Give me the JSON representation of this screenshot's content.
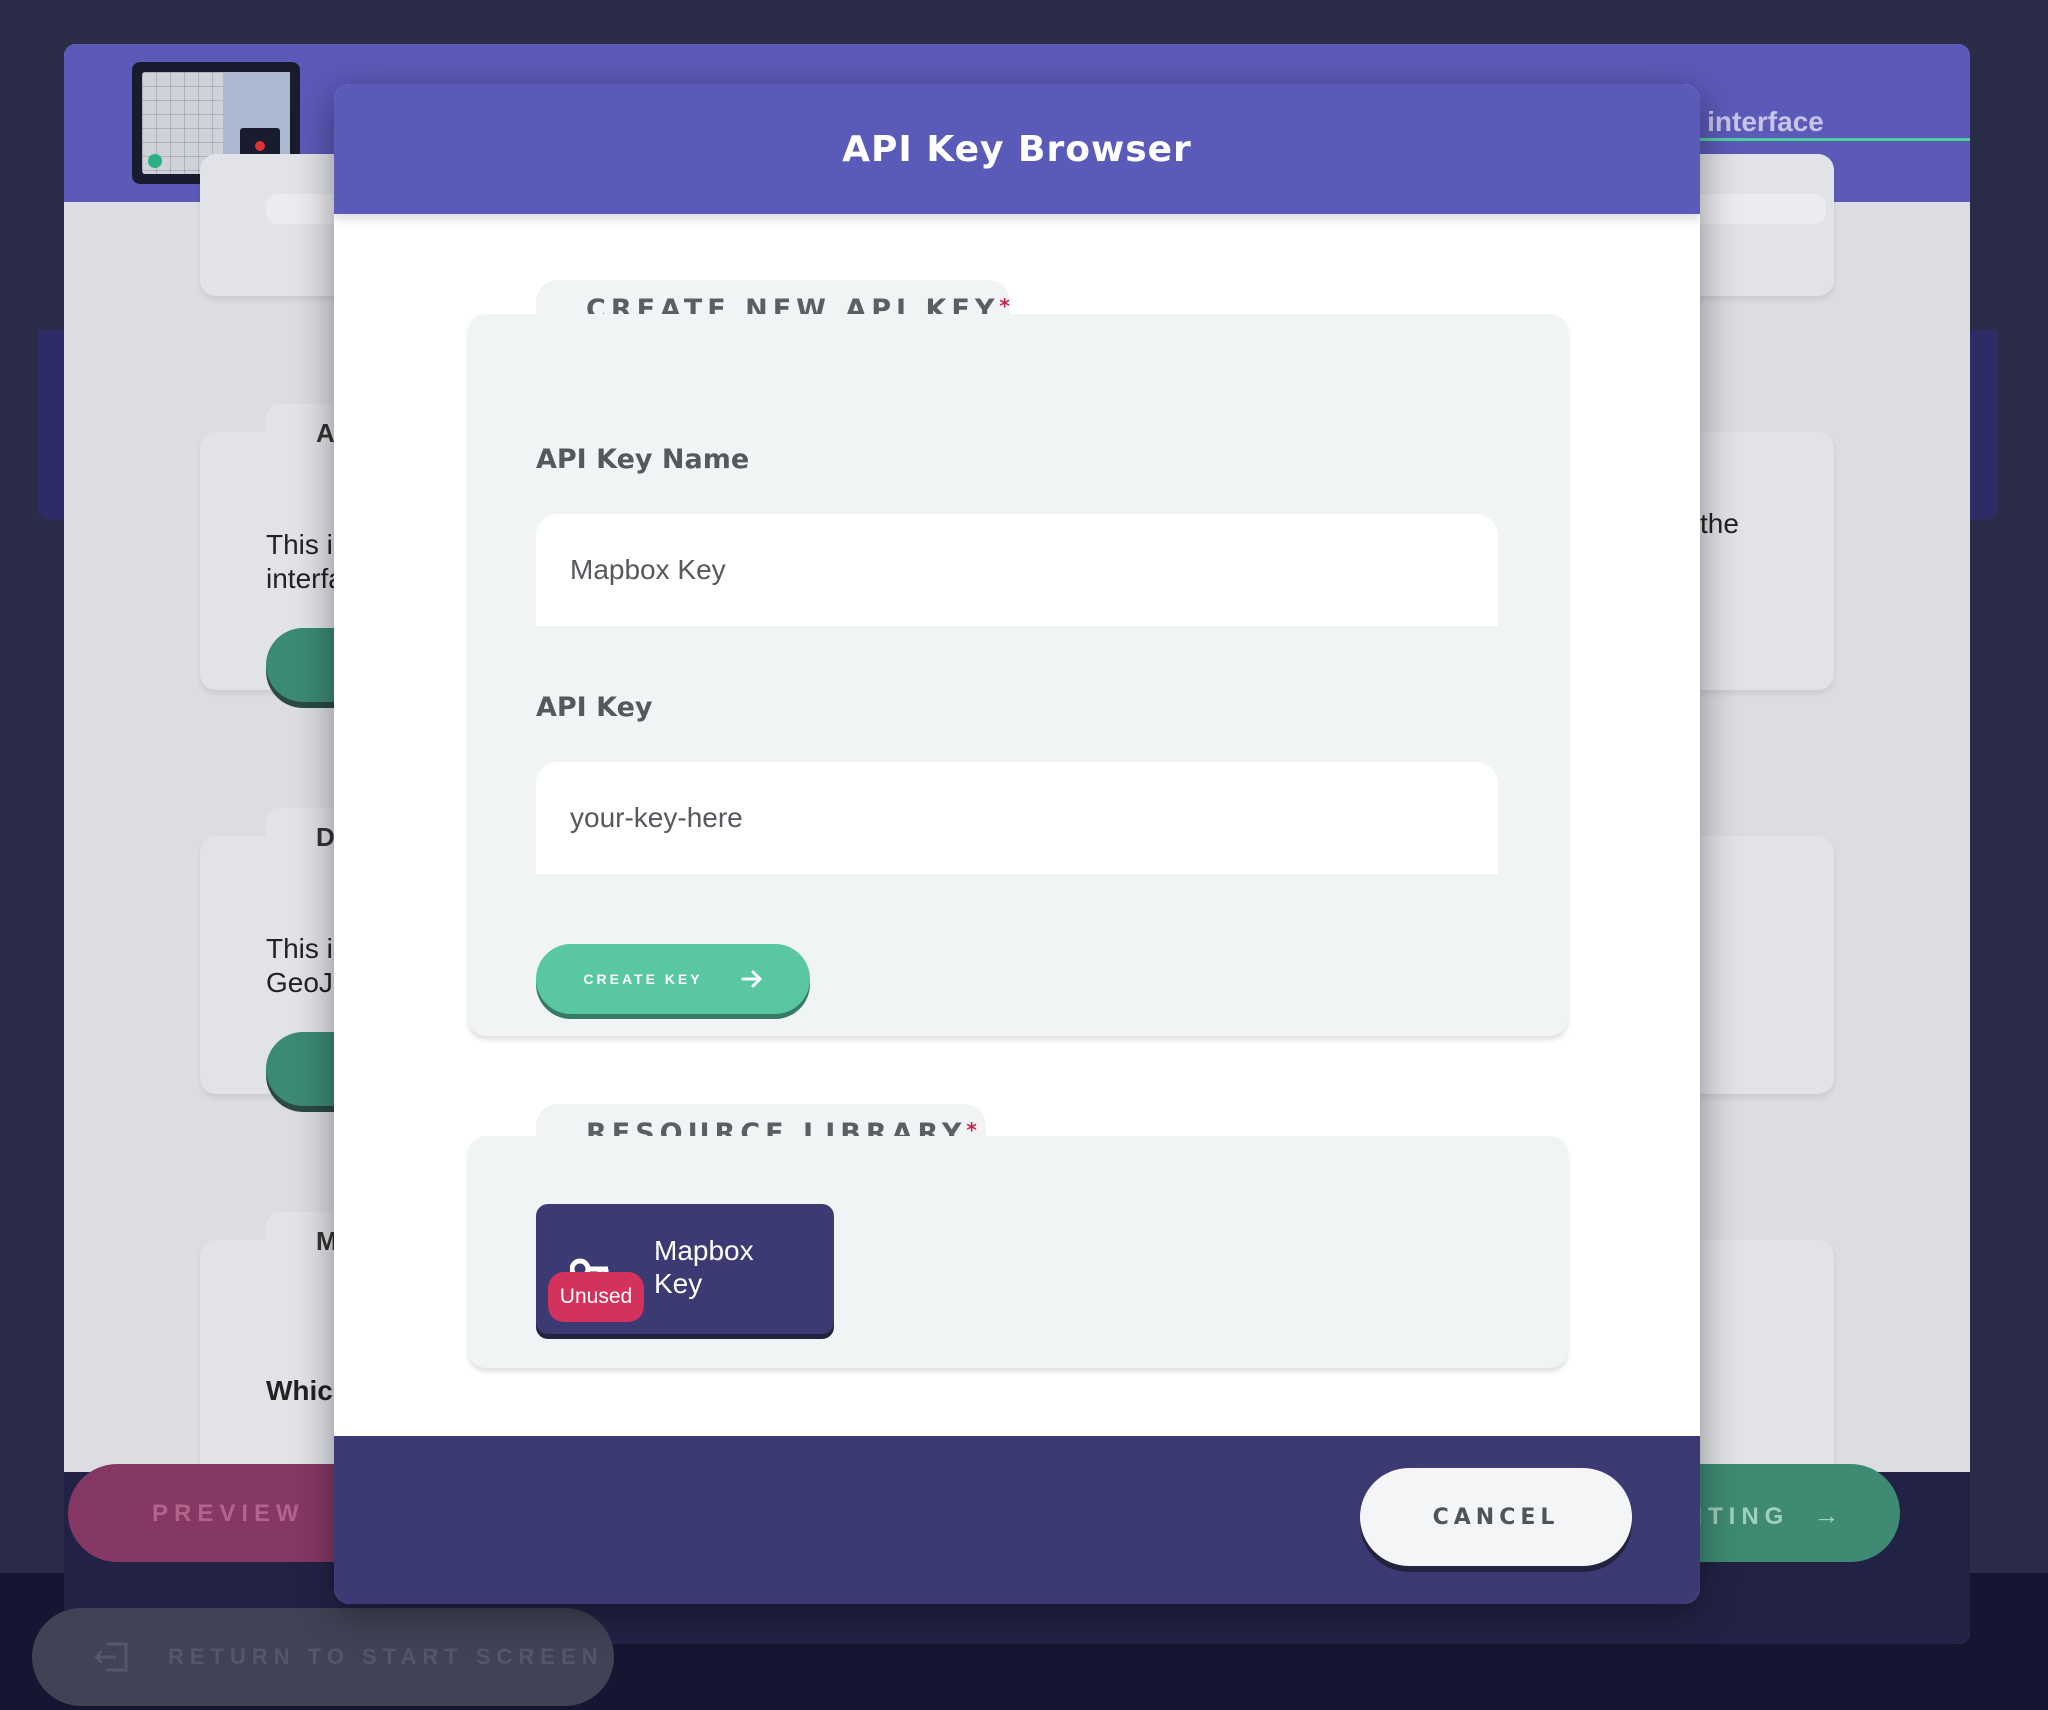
{
  "background_app": {
    "help_link_text": "Help for this interface",
    "card_letters": [
      "A",
      "D",
      "M"
    ],
    "card_texts": [
      "This i\ninterfa",
      "This i\nGeoJ",
      "Which"
    ],
    "right_text": "the",
    "preview_button": "PREVIEW",
    "editing_button": "EDITING",
    "editing_arrow": "→",
    "return_button": "RETURN TO START SCREEN"
  },
  "modal": {
    "title": "API Key Browser",
    "create_section": {
      "heading": "CREATE NEW API KEY",
      "required_mark": "*",
      "name_label": "API Key Name",
      "name_value": "Mapbox Key",
      "key_label": "API Key",
      "key_placeholder": "your-key-here",
      "create_button": "CREATE KEY"
    },
    "library_section": {
      "heading": "RESOURCE LIBRARY",
      "required_mark": "*",
      "resources": [
        {
          "name": "Mapbox Key",
          "status": "Unused",
          "icon": "key-icon"
        }
      ]
    },
    "cancel_button": "CANCEL"
  },
  "colors": {
    "modal_header": "#5a5bb8",
    "modal_footer": "#3b3a72",
    "accent_green": "#58c7a2",
    "badge_red": "#d3325c",
    "required_red": "#c8254e"
  }
}
